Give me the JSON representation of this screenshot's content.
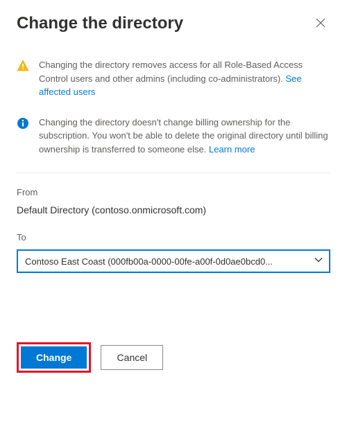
{
  "title": "Change the directory",
  "warning": {
    "text": "Changing the directory removes access for all Role-Based Access Control users and other admins (including co-administrators). ",
    "link_text": "See affected users"
  },
  "info": {
    "text": "Changing the directory doesn't change billing ownership for the subscription. You won't be able to delete the original directory until billing ownership is transferred to someone else. ",
    "link_text": "Learn more"
  },
  "from_label": "From",
  "from_value": "Default Directory (contoso.onmicrosoft.com)",
  "to_label": "To",
  "to_value": "Contoso East Coast (000fb00a-0000-00fe-a00f-0d0ae0bcd0...",
  "buttons": {
    "change": "Change",
    "cancel": "Cancel"
  },
  "colors": {
    "primary": "#0078d4",
    "warning": "#ffb900",
    "highlight": "#e81123"
  }
}
